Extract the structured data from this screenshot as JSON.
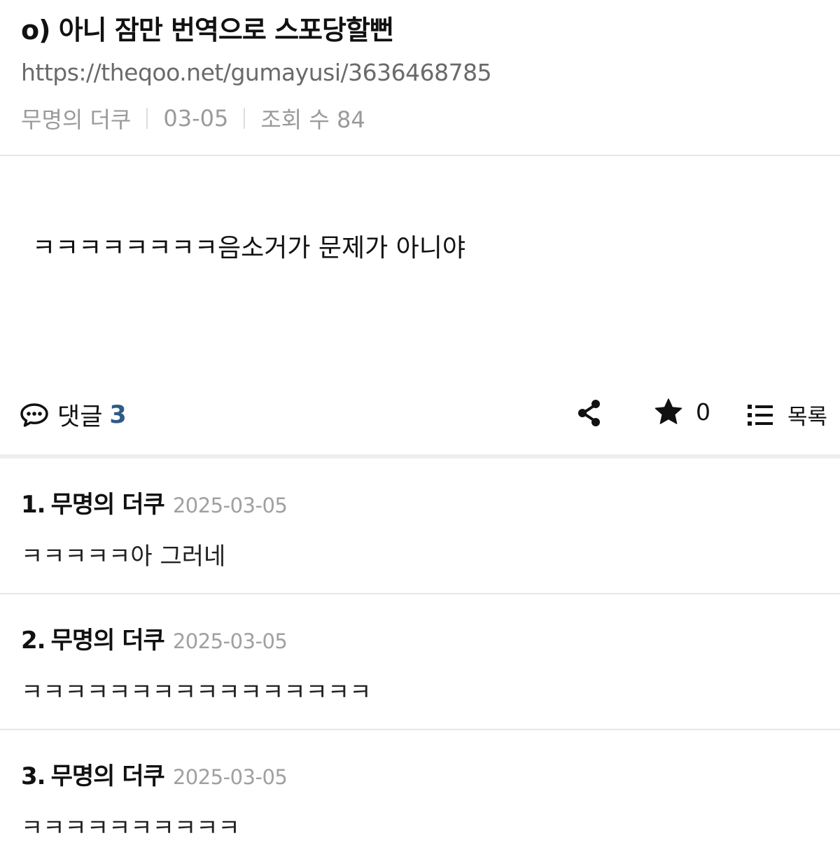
{
  "post": {
    "title": "o) 아니 잠만 번역으로 스포당할뻔",
    "url": "https://theqoo.net/gumayusi/3636468785",
    "author": "무명의 더쿠",
    "date": "03-05",
    "views_label": "조회 수 84",
    "body": "ㅋㅋㅋㅋㅋㅋㅋㅋ음소거가 문제가 아니야"
  },
  "actions": {
    "comment_label": "댓글",
    "comment_count": "3",
    "star_count": "0",
    "list_label": "목록",
    "icons": [
      "speech-bubble-icon",
      "share-icon",
      "star-icon",
      "list-icon"
    ]
  },
  "comments": [
    {
      "num": "1.",
      "author": "무명의 더쿠",
      "date": "2025-03-05",
      "text": "ㅋㅋㅋㅋㅋ아 그러네"
    },
    {
      "num": "2.",
      "author": "무명의 더쿠",
      "date": "2025-03-05",
      "text": "ㅋㅋㅋㅋㅋㅋㅋㅋㅋㅋㅋㅋㅋㅋㅋㅋ"
    },
    {
      "num": "3.",
      "author": "무명의 더쿠",
      "date": "2025-03-05",
      "text": "ㅋㅋㅋㅋㅋㅋㅋㅋㅋㅋ"
    }
  ]
}
